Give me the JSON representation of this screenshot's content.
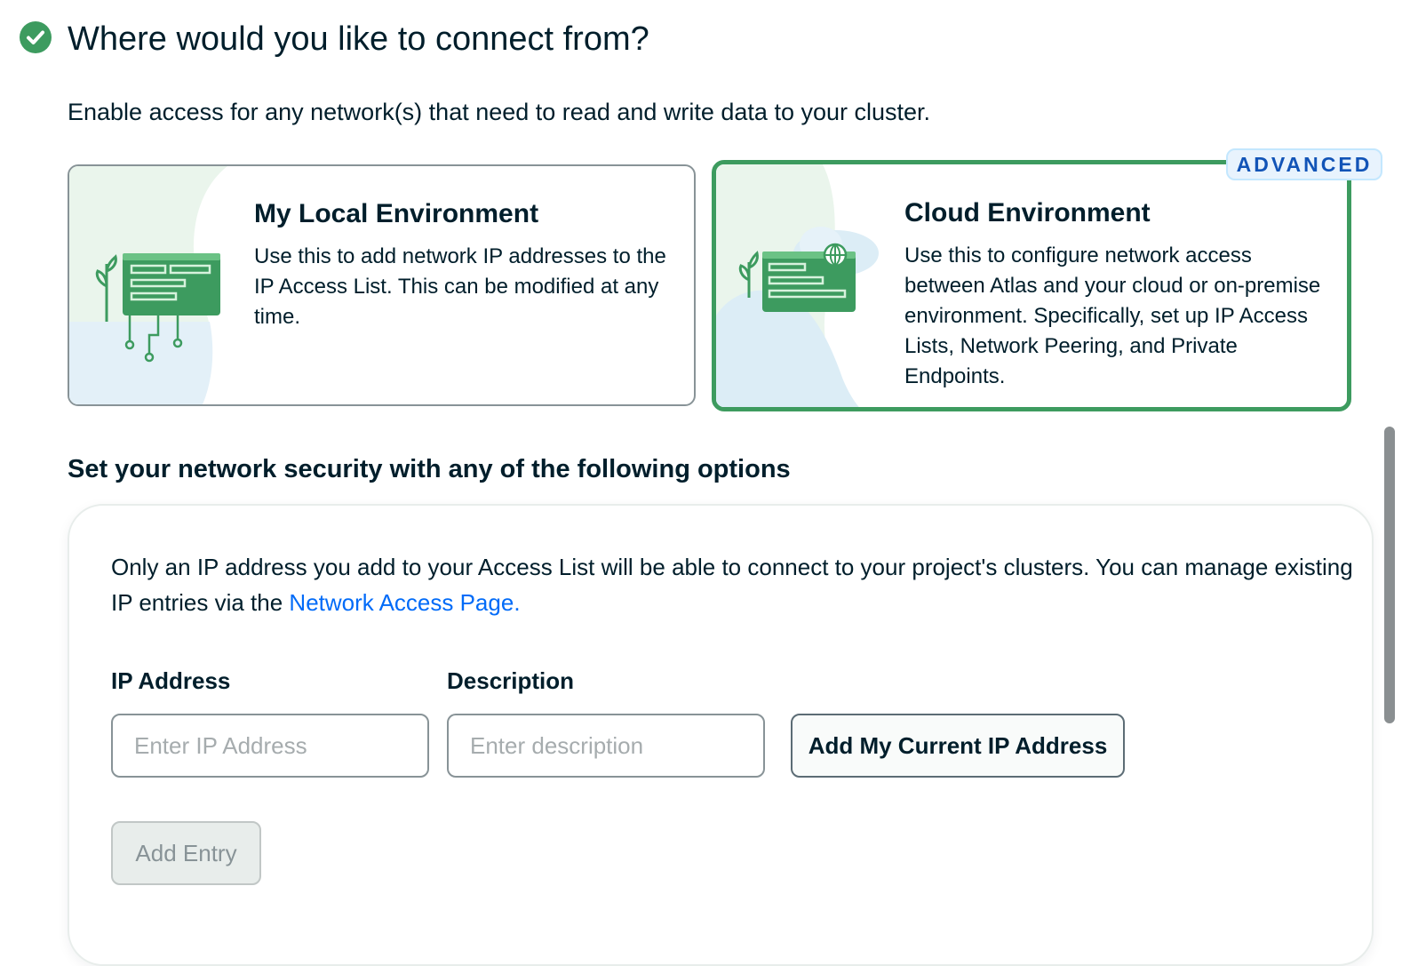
{
  "header": {
    "title": "Where would you like to connect from?",
    "subtitle": "Enable access for any network(s) that need to read and write data to your cluster."
  },
  "environments": {
    "local": {
      "title": "My Local Environment",
      "description": "Use this to add network IP addresses to the IP Access List. This can be modified at any time."
    },
    "cloud": {
      "badge": "ADVANCED",
      "title": "Cloud Environment",
      "description": "Use this to configure network access between Atlas and your cloud or on-premise environment. Specifically, set up IP Access Lists, Network Peering, and Private Endpoints.",
      "selected": true
    }
  },
  "security": {
    "heading": "Set your network security with any of the following options",
    "info_text": "Only an IP address you add to your Access List will be able to connect to your project's clusters. You can manage existing IP entries via the ",
    "info_link": "Network Access Page.",
    "ip_label": "IP Address",
    "ip_placeholder": "Enter IP Address",
    "ip_value": "",
    "description_label": "Description",
    "description_placeholder": "Enter description",
    "description_value": "",
    "add_current_ip_label": "Add My Current IP Address",
    "add_entry_label": "Add Entry"
  },
  "colors": {
    "brand_green": "#3d9b5f",
    "link_blue": "#016bf8",
    "badge_text": "#1254b7",
    "badge_bg": "#e8f3fd",
    "text": "#001e2b"
  }
}
